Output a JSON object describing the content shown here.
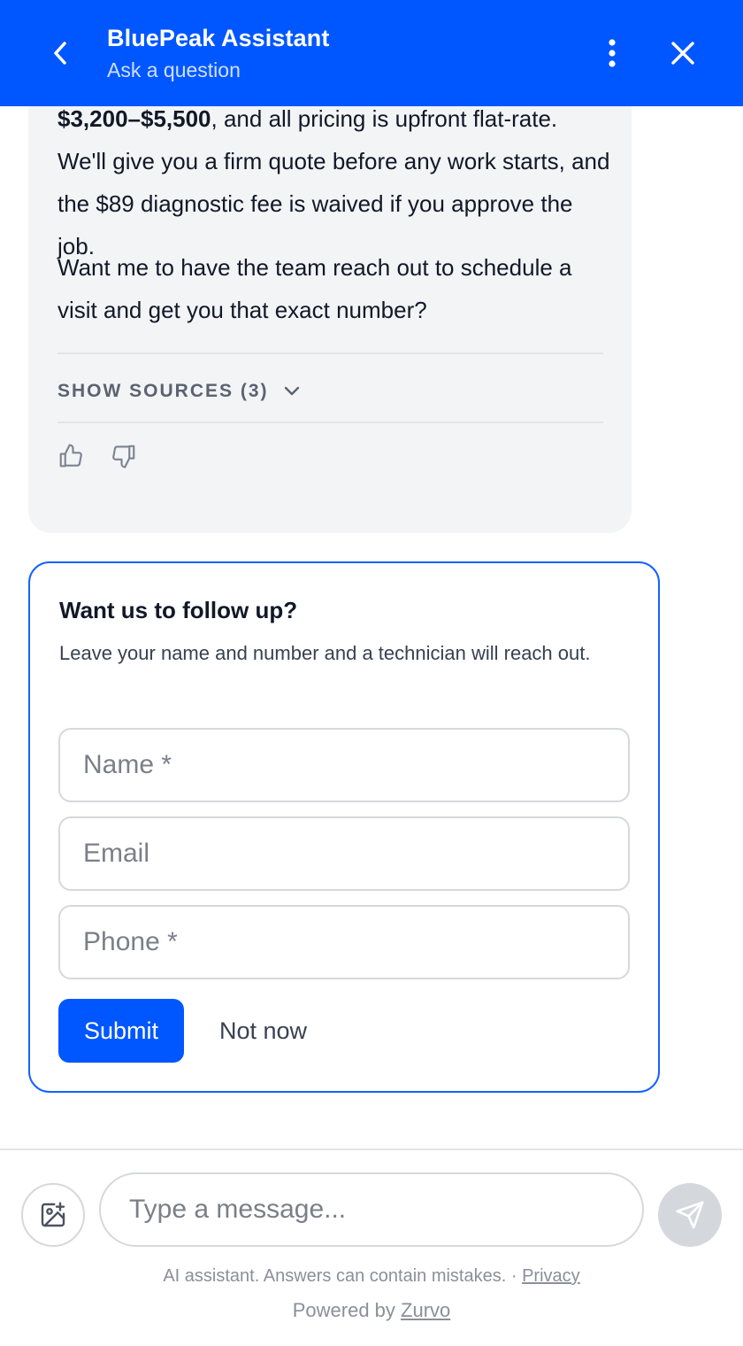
{
  "header": {
    "title": "BluePeak Assistant",
    "subtitle": "Ask a question",
    "background": "#0057ff"
  },
  "bubble": {
    "p1_bold": "$3,200–$5,500",
    "p1_rest": ", and all pricing is upfront flat-rate. We'll give you a firm quote before any work starts, and the $89 diagnostic fee is waived if you approve the job.",
    "p2": "Want me to have the team reach out to schedule a visit and get you that exact number?",
    "sources_label": "SHOW SOURCES (3)",
    "icons": [
      "chevron-down-icon",
      "thumbs-up-icon",
      "thumbs-down-icon"
    ]
  },
  "followup": {
    "title": "Want us to follow up?",
    "description": "Leave your name and number and a technician will reach out.",
    "fields": {
      "name_placeholder": "Name *",
      "email_placeholder": "Email",
      "phone_placeholder": "Phone *"
    },
    "submit_label": "Submit",
    "not_now_label": "Not now",
    "accent": "#1463ff"
  },
  "composer": {
    "placeholder": "Type a message...",
    "send_color": "#d4d7dc"
  },
  "footer": {
    "disclaimer": "AI assistant. Answers can contain mistakes. · ",
    "privacy_label": "Privacy",
    "powered_prefix": "Powered by ",
    "brand_label": "Zurvo"
  }
}
